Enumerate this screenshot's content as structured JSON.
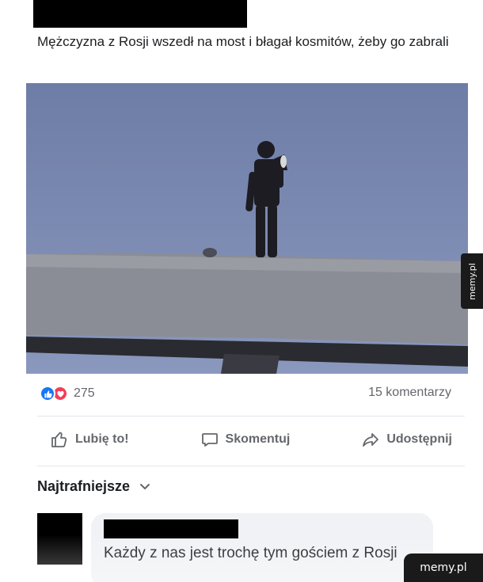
{
  "post": {
    "caption": "Mężczyzna z Rosji wszedł na most i błagał kosmitów, żeby go zabrali",
    "reaction_count": "275",
    "comments_count": "15 komentarzy",
    "reaction_icons": [
      "like-reaction-icon",
      "love-reaction-icon"
    ]
  },
  "actions": {
    "like_label": "Lubię to!",
    "comment_label": "Skomentuj",
    "share_label": "Udostępnij"
  },
  "comments": {
    "sort_label": "Najtrafniejsze",
    "items": [
      {
        "text": "Każdy z nas jest trochę tym gościem z Rosji"
      }
    ]
  },
  "watermark": {
    "side_text": "memy.pl",
    "corner_text": "memy.pl"
  },
  "colors": {
    "like_blue": "#1877f2",
    "love_red": "#f33e58",
    "muted_text": "#65676b",
    "bubble_bg": "#f0f2f5"
  }
}
